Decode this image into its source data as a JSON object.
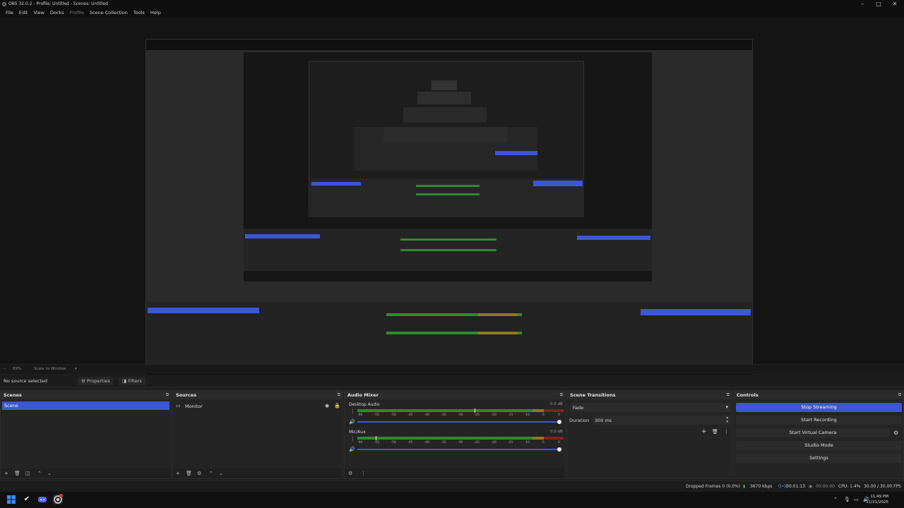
{
  "window": {
    "title": "OBS 32.0.2 - Profile: Untitled - Scenes: Untitled",
    "minimize_icon": "minimize-icon",
    "maximize_icon": "maximize-icon",
    "close_icon": "close-icon"
  },
  "menu": [
    "File",
    "Edit",
    "View",
    "Docks",
    "Profile",
    "Scene Collection",
    "Tools",
    "Help"
  ],
  "zoom": {
    "level": "89%",
    "mode": "Scale to Window"
  },
  "context_bar": {
    "status": "No source selected",
    "properties_label": "Properties",
    "filters_label": "Filters"
  },
  "scenes": {
    "title": "Scenes",
    "items": [
      "Scene"
    ]
  },
  "sources": {
    "title": "Sources",
    "items": [
      {
        "name": "Monitor",
        "icon": "monitor-icon",
        "visible_icon": "eye-icon",
        "lock_icon": "lock-icon"
      }
    ]
  },
  "audio_mixer": {
    "title": "Audio Mixer",
    "channels": [
      {
        "name": "Desktop Audio",
        "db": "0.0 dB",
        "level": 0.57
      },
      {
        "name": "Mic/Aux",
        "db": "0.0 dB",
        "level": 0.09
      }
    ],
    "ticks": [
      "-60",
      "-55",
      "-50",
      "-45",
      "-40",
      "-35",
      "-30",
      "-25",
      "-20",
      "-15",
      "-10",
      "-5",
      "0"
    ],
    "colors": {
      "green": "#2e8b2e",
      "yellow": "#8f7a1c",
      "red": "#8a1e1e"
    }
  },
  "scene_transitions": {
    "title": "Scene Transitions",
    "transition": "Fade",
    "duration_label": "Duration",
    "duration": "300 ms"
  },
  "controls": {
    "title": "Controls",
    "stop_streaming": "Stop Streaming",
    "start_recording": "Start Recording",
    "start_virtual_camera": "Start Virtual Camera",
    "studio_mode": "Studio Mode",
    "settings": "Settings"
  },
  "status": {
    "dropped_frames": "Dropped Frames 0 (0.0%)",
    "bitrate": "3670 kbps",
    "stream_time": "00:01:13",
    "record_time": "00:00:00",
    "cpu": "CPU: 1.4%",
    "fps": "30.00 / 30.00 FPS"
  },
  "taskbar": {
    "time": "11:49 PM",
    "date": "11/21/2025"
  },
  "accent": "#3b57d6"
}
